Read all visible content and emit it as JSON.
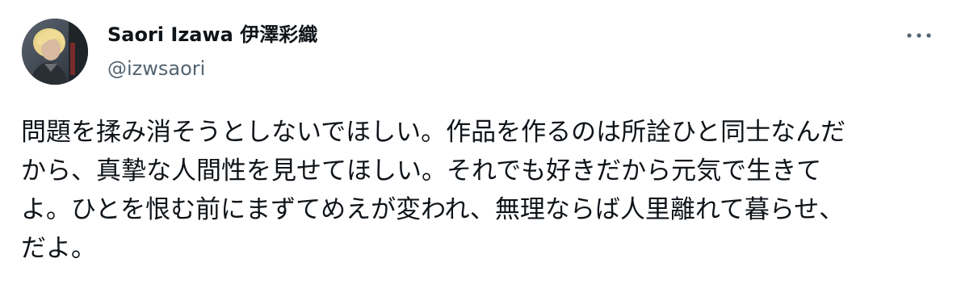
{
  "author": {
    "display_name": "Saori Izawa 伊澤彩織",
    "handle": "@izwsaori",
    "avatar": "user-avatar-photo"
  },
  "more_menu_icon": "more-options-icon",
  "tweet": {
    "lines": [
      "問題を揉み消そうとしないでほしい。作品を作るのは所詮ひと同士なんだ",
      "から、真摯な人間性を見せてほしい。それでも好きだから元気で生きて",
      "よ。ひとを恨む前にまずてめえが変われ、無理ならば人里離れて暮らせ、",
      "だよ。"
    ]
  },
  "colors": {
    "text": "#0f1419",
    "secondary": "#536471",
    "background": "#ffffff"
  }
}
